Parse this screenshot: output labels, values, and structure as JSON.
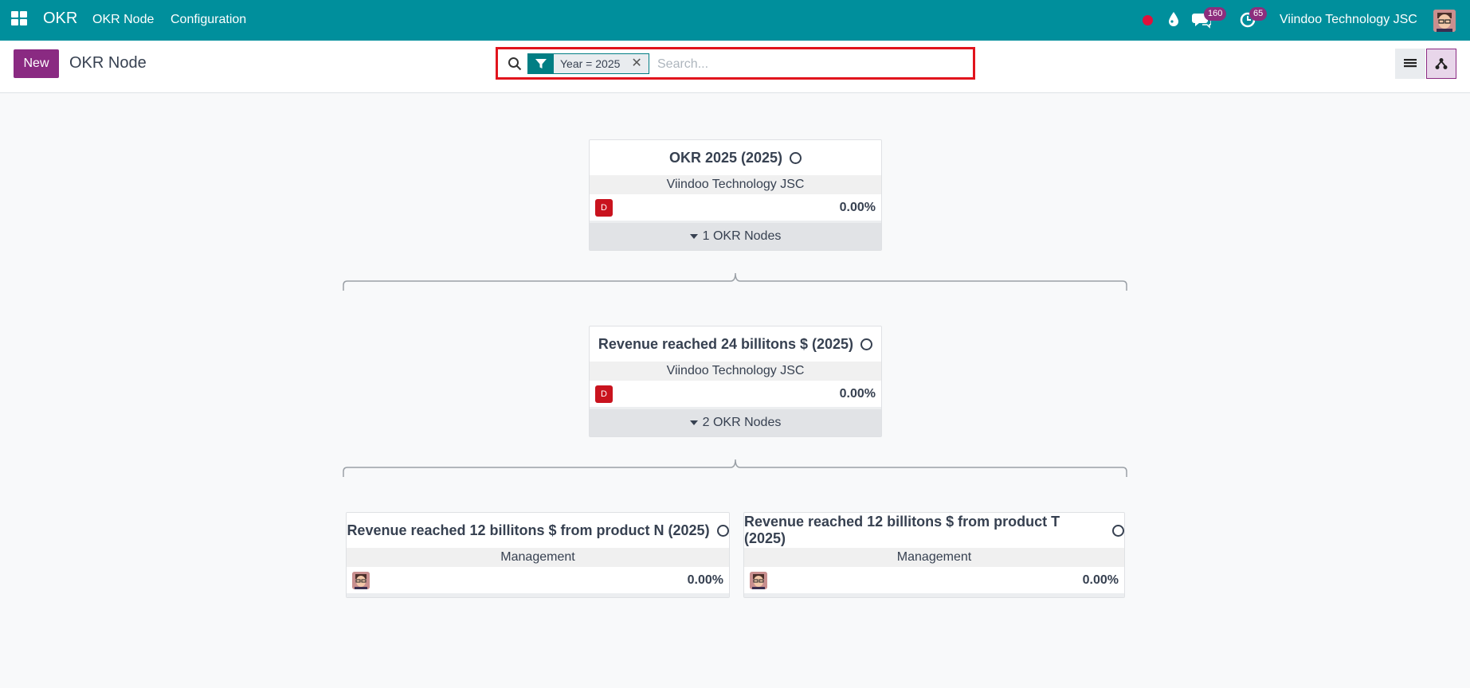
{
  "navbar": {
    "brand": "OKR",
    "menu": [
      "OKR Node",
      "Configuration"
    ],
    "chat_count": "160",
    "activity_count": "65",
    "company": "Viindoo Technology JSC",
    "bg_color": "#008f9c"
  },
  "control": {
    "new_label": "New",
    "breadcrumb": "OKR Node",
    "facet": "Year = 2025",
    "search_placeholder": "Search...",
    "accent": "#8a2a82"
  },
  "nodes": {
    "root": {
      "title": "OKR 2025 (2025)",
      "company": "Viindoo Technology JSC",
      "badge": "D",
      "progress": "0.00%",
      "children_label": "1 OKR Nodes"
    },
    "mid": {
      "title": "Revenue reached 24 billitons $ (2025)",
      "company": "Viindoo Technology JSC",
      "badge": "D",
      "progress": "0.00%",
      "children_label": "2 OKR Nodes"
    },
    "leaf_n": {
      "title": "Revenue reached 12 billitons $ from product N (2025)",
      "company": "Management",
      "progress": "0.00%"
    },
    "leaf_t": {
      "title": "Revenue reached 12 billitons $ from product T (2025)",
      "company": "Management",
      "progress": "0.00%"
    }
  }
}
